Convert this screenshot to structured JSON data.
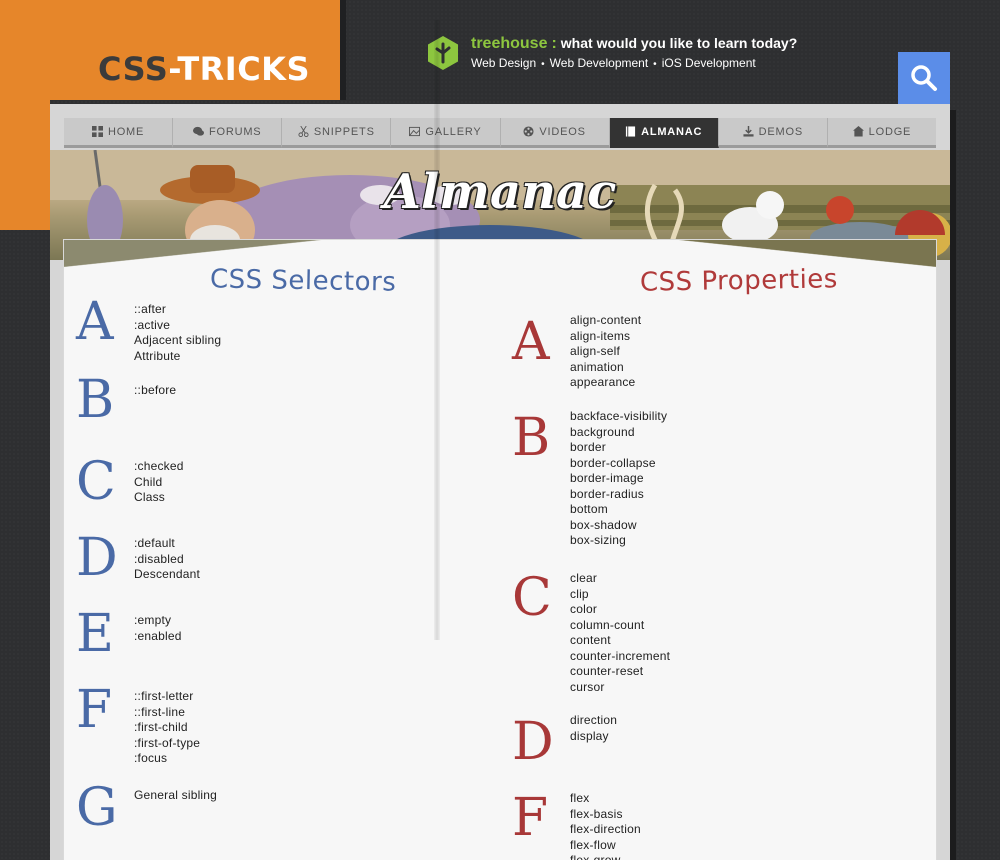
{
  "logo": {
    "part1": "CSS",
    "dash": "-",
    "part2": "TRICKS"
  },
  "promo": {
    "brand": "treehouse",
    "colon": ":",
    "tagline": "what would you like to learn today?",
    "links": [
      "Web Design",
      "Web Development",
      "iOS Development"
    ],
    "separator": "•",
    "brand_color": "#8dc63f"
  },
  "search": {
    "icon": "search-icon",
    "bg": "#5b8de8"
  },
  "nav": [
    {
      "label": "HOME",
      "icon": "grid-icon",
      "active": false
    },
    {
      "label": "FORUMS",
      "icon": "chat-bubbles-icon",
      "active": false
    },
    {
      "label": "SNIPPETS",
      "icon": "scissors-icon",
      "active": false
    },
    {
      "label": "GALLERY",
      "icon": "picture-icon",
      "active": false
    },
    {
      "label": "VIDEOS",
      "icon": "film-reel-icon",
      "active": false
    },
    {
      "label": "ALMANAC",
      "icon": "book-icon",
      "active": true
    },
    {
      "label": "DEMOS",
      "icon": "download-icon",
      "active": false
    },
    {
      "label": "LODGE",
      "icon": "lodge-icon",
      "active": false
    }
  ],
  "banner": {
    "title": "Almanac"
  },
  "left_page": {
    "title": "CSS Selectors",
    "sections": [
      {
        "letter": "A",
        "items": [
          "::after",
          ":active",
          "Adjacent sibling",
          "Attribute"
        ]
      },
      {
        "letter": "B",
        "items": [
          "::before"
        ]
      },
      {
        "letter": "C",
        "items": [
          ":checked",
          "Child",
          "Class"
        ]
      },
      {
        "letter": "D",
        "items": [
          ":default",
          ":disabled",
          "Descendant"
        ]
      },
      {
        "letter": "E",
        "items": [
          ":empty",
          ":enabled"
        ]
      },
      {
        "letter": "F",
        "items": [
          "::first-letter",
          "::first-line",
          ":first-child",
          ":first-of-type",
          ":focus"
        ]
      },
      {
        "letter": "G",
        "items": [
          "General sibling"
        ]
      }
    ]
  },
  "right_page": {
    "title": "CSS Properties",
    "sections": [
      {
        "letter": "A",
        "items": [
          "align-content",
          "align-items",
          "align-self",
          "animation",
          "appearance"
        ]
      },
      {
        "letter": "B",
        "items": [
          "backface-visibility",
          "background",
          "border",
          "border-collapse",
          "border-image",
          "border-radius",
          "bottom",
          "box-shadow",
          "box-sizing"
        ]
      },
      {
        "letter": "C",
        "items": [
          "clear",
          "clip",
          "color",
          "column-count",
          "content",
          "counter-increment",
          "counter-reset",
          "cursor"
        ]
      },
      {
        "letter": "D",
        "items": [
          "direction",
          "display"
        ]
      },
      {
        "letter": "F",
        "items": [
          "flex",
          "flex-basis",
          "flex-direction",
          "flex-flow",
          "flex-grow"
        ]
      }
    ]
  },
  "colors": {
    "accent": "#e6862a",
    "selectors": "#4a6aa6",
    "properties": "#a83838"
  }
}
